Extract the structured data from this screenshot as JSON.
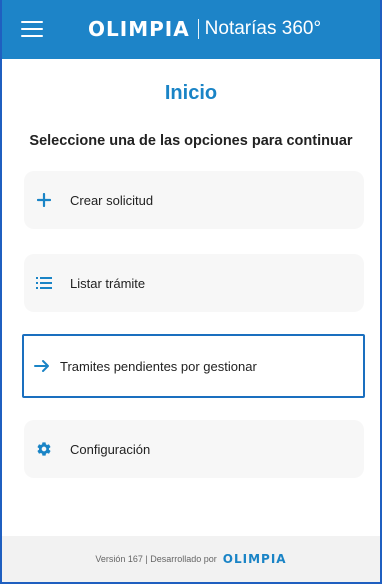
{
  "header": {
    "menu_icon": "hamburger-menu-icon",
    "brand": "OLIMPIA",
    "product": "Notarías 360°"
  },
  "main": {
    "title": "Inicio",
    "subtitle": "Seleccione una de las opciones para continuar",
    "options": [
      {
        "label": "Crear solicitud",
        "icon": "plus-icon"
      },
      {
        "label": "Listar trámite",
        "icon": "list-icon"
      },
      {
        "label": "Tramites pendientes por gestionar",
        "icon": "arrow-right-icon"
      },
      {
        "label": "Configuración",
        "icon": "gear-icon"
      }
    ]
  },
  "footer": {
    "version_text": "Versión 167 | Desarrollado por",
    "brand": "OLIMPIA"
  },
  "colors": {
    "primary": "#1d84c8",
    "selected_border": "#1a6fbf",
    "card_bg": "#f7f7f7",
    "footer_bg": "#f2f2f2"
  }
}
